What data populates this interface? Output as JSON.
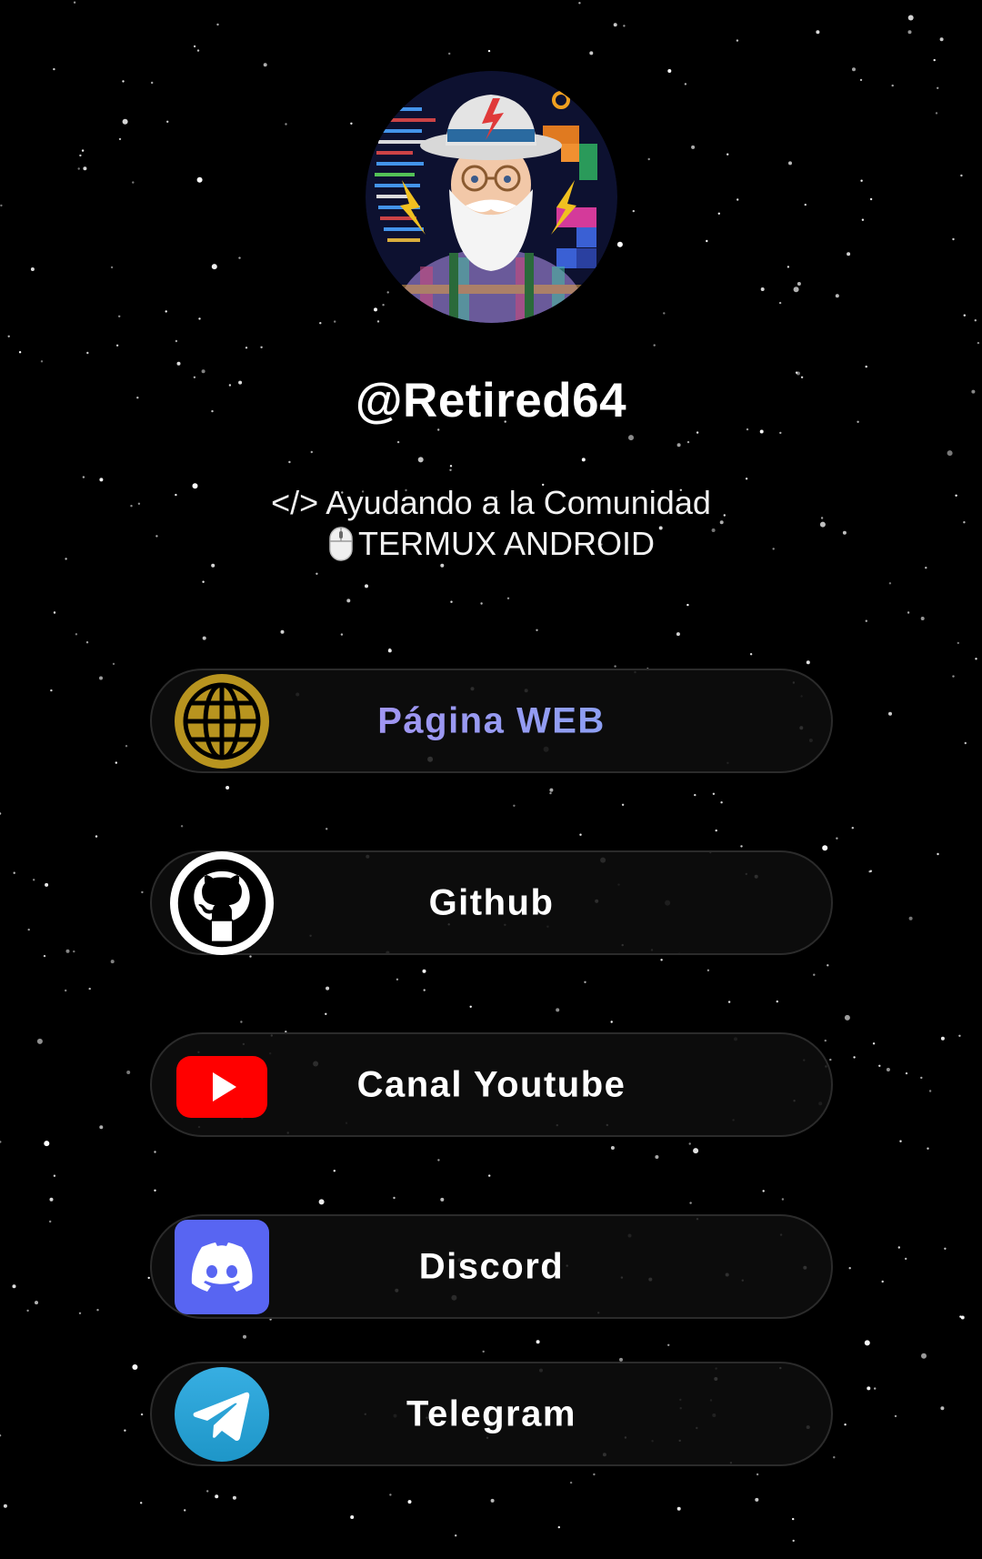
{
  "profile": {
    "username": "@Retired64",
    "bio_line1": "</> Ayudando a la Comunidad",
    "bio_line2": "TERMUX ANDROID",
    "avatar_icon": "retro-coder-grandpa-avatar"
  },
  "links": [
    {
      "label": "Página WEB",
      "icon": "globe-icon",
      "color": "#b8941f"
    },
    {
      "label": "Github",
      "icon": "github-icon",
      "color": "#ffffff"
    },
    {
      "label": "Canal Youtube",
      "icon": "youtube-icon",
      "color": "#ff0000"
    },
    {
      "label": "Discord",
      "icon": "discord-icon",
      "color": "#5865f2"
    },
    {
      "label": "Telegram",
      "icon": "telegram-icon",
      "color": "#2aa1da"
    }
  ],
  "theme": {
    "background": "#000000",
    "button_border": "#2b2b2b",
    "web_label_gradient": [
      "#b48cf0",
      "#7aa9f5"
    ]
  }
}
